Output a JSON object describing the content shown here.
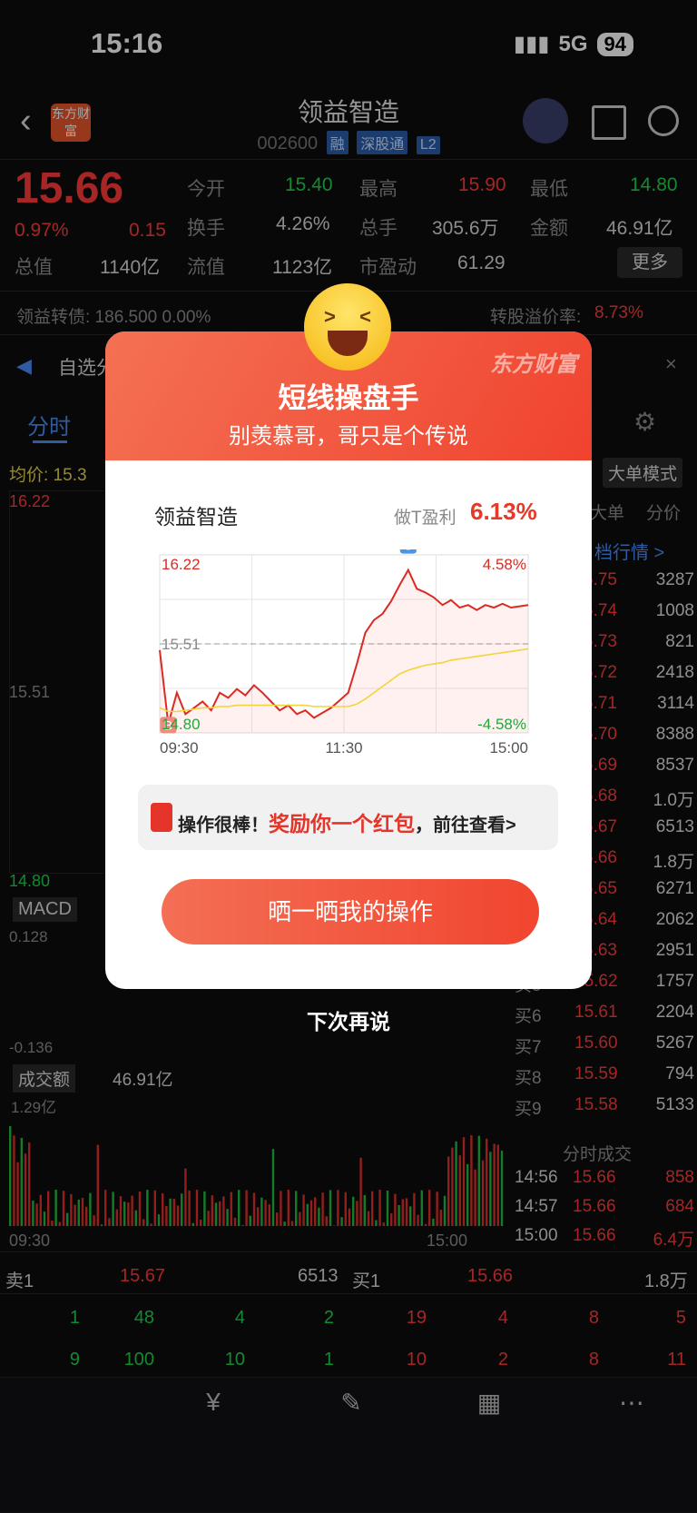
{
  "status": {
    "time": "15:16",
    "network": "5G",
    "battery": "94"
  },
  "header": {
    "title": "领益智造",
    "code": "002600",
    "tags": [
      "融",
      "深股通",
      "L2"
    ],
    "logo_text": "东方财富"
  },
  "quote": {
    "price": "15.66",
    "change_pct": "0.97%",
    "change": "0.15",
    "total_value_label": "总值",
    "total_value": "1140亿",
    "open_label": "今开",
    "open": "15.40",
    "turnover_label": "换手",
    "turnover": "4.26%",
    "float_label": "流值",
    "float_value": "1123亿",
    "high_label": "最高",
    "high": "15.90",
    "volume_label": "总手",
    "volume": "305.6万",
    "pe_label": "市盈动",
    "pe": "61.29",
    "low_label": "最低",
    "low": "14.80",
    "amount_label": "金额",
    "amount": "46.91亿",
    "more": "更多"
  },
  "bond": {
    "text": "领益转债: 186.500  0.00%",
    "premium_label": "转股溢价率:",
    "premium": "8.73%"
  },
  "notice": {
    "text": "自选分"
  },
  "chart_tabs": {
    "active": "分时",
    "avg": "均价: 15.3",
    "mode": "大单模式"
  },
  "left_chart": {
    "top": "16.22",
    "mid": "15.51",
    "bottom": "14.80",
    "macd": "MACD",
    "macd_top": "0.128",
    "macd_bottom": "-0.136",
    "vol_label": "成交额",
    "vol_total": "46.91亿",
    "vol_top": "1.29亿",
    "t_start": "09:30",
    "t_end": "15:00"
  },
  "order_book": {
    "headers": [
      "大单",
      "分价"
    ],
    "link": "档行情 >",
    "sells": [
      [
        "5.75",
        "3287"
      ],
      [
        "5.74",
        "1008"
      ],
      [
        "5.73",
        "821"
      ],
      [
        "5.72",
        "2418"
      ],
      [
        "5.71",
        "3114"
      ],
      [
        "5.70",
        "8388"
      ],
      [
        "5.69",
        "8537"
      ],
      [
        "5.68",
        "1.0万"
      ],
      [
        "5.67",
        "6513"
      ]
    ],
    "buys": [
      [
        "5.66",
        "1.8万"
      ],
      [
        "5.65",
        "6271"
      ],
      [
        "5.64",
        "2062"
      ],
      [
        "5.63",
        "2951"
      ],
      [
        "买5",
        "15.62",
        "1757"
      ],
      [
        "买6",
        "15.61",
        "2204"
      ],
      [
        "买7",
        "15.60",
        "5267"
      ],
      [
        "买8",
        "15.59",
        "794"
      ],
      [
        "买9",
        "15.58",
        "5133"
      ]
    ],
    "ticks_label": "分时成交",
    "ticks": [
      [
        "14:56",
        "15.66",
        "858"
      ],
      [
        "14:57",
        "15.66",
        "684"
      ],
      [
        "15:00",
        "15.66",
        "6.4万"
      ]
    ]
  },
  "level1": {
    "sell1": "卖1",
    "sell1_price": "15.67",
    "sell1_vol": "6513",
    "buy1": "买1",
    "buy1_price": "15.66",
    "buy1_vol": "1.8万",
    "row1_left": [
      "1",
      "48",
      "4",
      "2"
    ],
    "row1_right": [
      "19",
      "4",
      "8",
      "5"
    ],
    "row2_left": [
      "9",
      "100",
      "10",
      "1"
    ],
    "row2_right": [
      "10",
      "2",
      "8",
      "11"
    ]
  },
  "modal": {
    "title": "短线操盘手",
    "subtitle": "别羡慕哥，哥只是个传说",
    "brand": "东方财富",
    "stock": "领益智造",
    "profit_label": "做T盈利",
    "profit": "6.13%",
    "reward_prefix": "操作很棒！",
    "reward_main": "奖励你一个红包",
    "reward_suffix": "，前往查看>",
    "cta": "晒一晒我的操作",
    "dismiss": "下次再说"
  },
  "chart_data": {
    "type": "line",
    "x": [
      "09:30",
      "11:30",
      "15:00"
    ],
    "ylim": [
      14.8,
      16.22
    ],
    "ref": 15.51,
    "right_ticks": [
      "4.58%",
      "-4.58%"
    ],
    "series": [
      {
        "values": [
          15.46,
          14.87,
          15.12,
          14.95,
          15.0,
          15.05,
          14.98,
          15.12,
          15.08,
          15.15,
          15.1,
          15.18,
          15.12,
          15.05,
          14.98,
          15.02,
          14.95,
          14.98,
          14.92,
          14.96,
          15.0,
          15.06,
          15.12,
          15.35,
          15.6,
          15.7,
          15.75,
          15.85,
          15.98,
          16.1,
          15.95,
          15.92,
          15.88,
          15.82,
          15.86,
          15.8,
          15.82,
          15.78,
          15.82,
          15.8,
          15.83,
          15.8,
          15.81,
          15.82
        ]
      },
      {
        "values": [
          15.0,
          14.97,
          14.97,
          14.98,
          14.99,
          15.0,
          15.0,
          15.01,
          15.01,
          15.02,
          15.02,
          15.02,
          15.02,
          15.02,
          15.02,
          15.02,
          15.02,
          15.02,
          15.01,
          15.01,
          15.01,
          15.01,
          15.01,
          15.03,
          15.07,
          15.12,
          15.17,
          15.22,
          15.27,
          15.3,
          15.32,
          15.34,
          15.35,
          15.36,
          15.38,
          15.39,
          15.4,
          15.41,
          15.42,
          15.43,
          15.44,
          15.45,
          15.46,
          15.47
        ]
      }
    ],
    "markers": [
      "B",
      "S"
    ]
  }
}
